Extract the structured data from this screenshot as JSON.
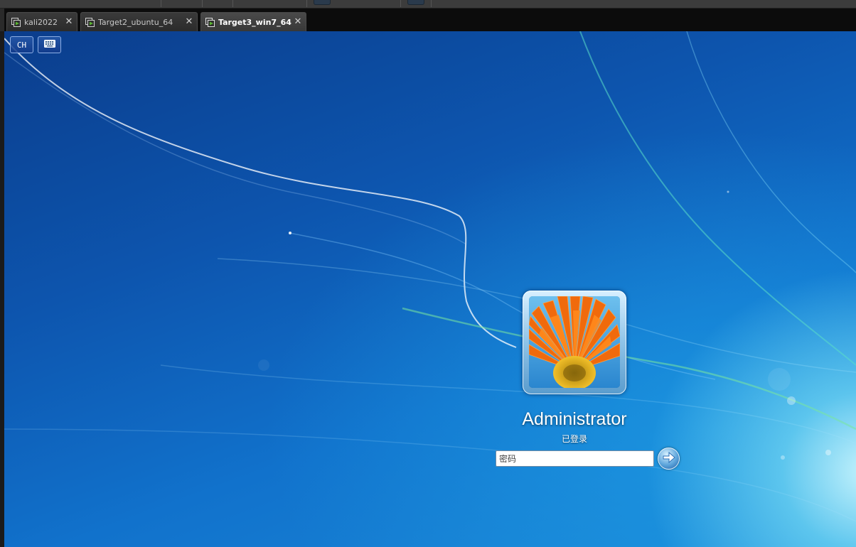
{
  "tabs": [
    {
      "label": "kali2022",
      "active": false
    },
    {
      "label": "Target2_ubuntu_64",
      "active": false
    },
    {
      "label": "Target3_win7_64",
      "active": true
    }
  ],
  "login": {
    "language_button": "CH",
    "keyboard_icon": "keyboard-icon",
    "user_name": "Administrator",
    "user_status": "已登录",
    "password_placeholder": "密码",
    "submit_icon": "arrow-right-icon"
  },
  "colors": {
    "accent": "#1172cc",
    "tab_active_text": "#ffffff",
    "vm_icon_green": "#5ab431"
  }
}
